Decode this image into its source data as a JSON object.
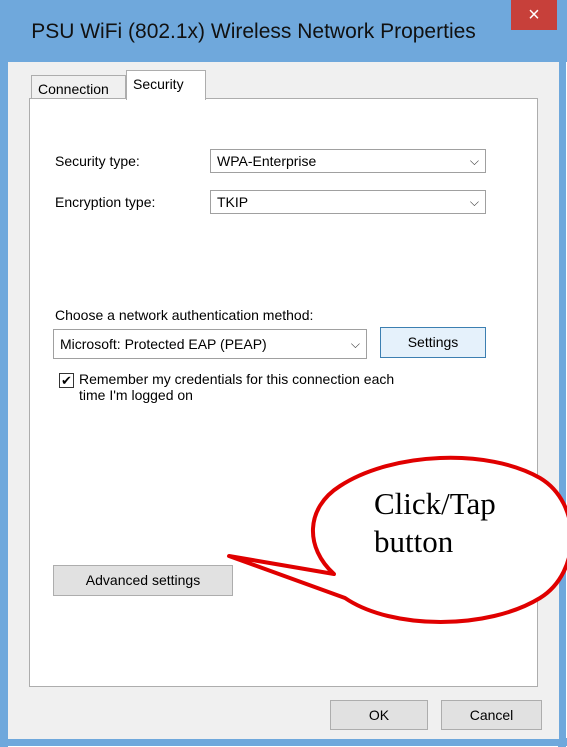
{
  "window": {
    "title": "PSU WiFi (802.1x) Wireless Network Properties",
    "close_icon": "×"
  },
  "tabs": [
    {
      "label": "Connection",
      "active": false
    },
    {
      "label": "Security",
      "active": true
    }
  ],
  "security": {
    "security_type_label": "Security type:",
    "security_type_value": "WPA-Enterprise",
    "encryption_type_label": "Encryption type:",
    "encryption_type_value": "TKIP",
    "auth_method_label": "Choose a network authentication method:",
    "auth_method_value": "Microsoft: Protected EAP (PEAP)",
    "settings_button": "Settings",
    "remember_label_line1": "Remember my credentials for this connection each",
    "remember_label_line2": "time I'm logged on",
    "remember_checked": true,
    "advanced_button": "Advanced settings"
  },
  "footer": {
    "ok_button": "OK",
    "cancel_button": "Cancel"
  },
  "annotation": {
    "line1": "Click/Tap",
    "line2": "button",
    "color": "#e00000"
  },
  "icons": {
    "chevron": "chevron-down-icon",
    "check": "✔"
  }
}
